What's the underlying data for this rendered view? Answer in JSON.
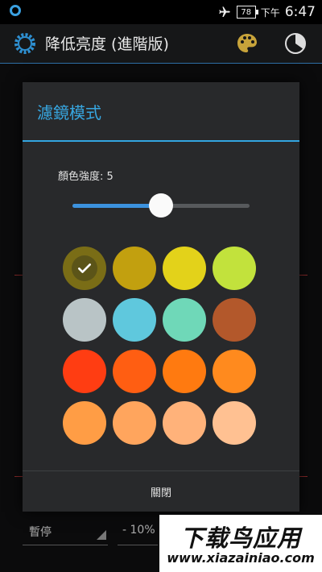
{
  "status_bar": {
    "battery": "78",
    "ampm": "下午",
    "time": "6:47"
  },
  "action_bar": {
    "title": "降低亮度 (進階版)",
    "icons": [
      "gear-icon",
      "palette-icon",
      "timer-icon"
    ]
  },
  "background": {
    "pause_label": "暫停",
    "brightness_step": "- 10%"
  },
  "dialog": {
    "title": "濾鏡模式",
    "strength_label": "顏色強度: 5",
    "slider_value": 5,
    "slider_max": 10,
    "swatches": [
      {
        "color": "#7a6d16",
        "selected": true
      },
      {
        "color": "#c2a00f",
        "selected": false
      },
      {
        "color": "#e3d21a",
        "selected": false
      },
      {
        "color": "#c2e23c",
        "selected": false
      },
      {
        "color": "#b9c4c6",
        "selected": false
      },
      {
        "color": "#5fc8dd",
        "selected": false
      },
      {
        "color": "#6fd8b8",
        "selected": false
      },
      {
        "color": "#b3582b",
        "selected": false
      },
      {
        "color": "#ff3d12",
        "selected": false
      },
      {
        "color": "#ff5e12",
        "selected": false
      },
      {
        "color": "#ff7a10",
        "selected": false
      },
      {
        "color": "#ff8a1e",
        "selected": false
      },
      {
        "color": "#ff9d45",
        "selected": false
      },
      {
        "color": "#ffa55d",
        "selected": false
      },
      {
        "color": "#ffb27a",
        "selected": false
      },
      {
        "color": "#ffc192",
        "selected": false
      }
    ],
    "close_label": "關閉"
  },
  "watermark": {
    "title": "下载鸟应用",
    "url": "www.xiazainiao.com"
  },
  "colors": {
    "accent": "#33a5e0",
    "dialog_bg": "#28292b",
    "slider_fill": "#3c92de"
  }
}
